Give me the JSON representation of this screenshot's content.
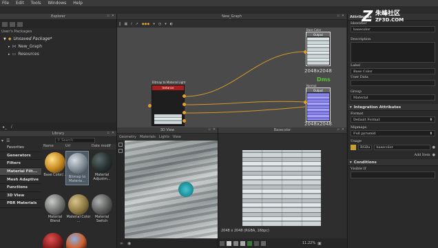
{
  "menu": [
    "File",
    "Edit",
    "Tools",
    "Windows",
    "Help"
  ],
  "explorer": {
    "title": "Explorer",
    "header": "User's Packages",
    "package": "Unsaved Package*",
    "items": [
      "New_Graph",
      "Resources"
    ]
  },
  "graph": {
    "title": "New_Graph",
    "nodes": {
      "base_color": {
        "title": "Base Color",
        "header": "Output",
        "res": "2048x2048"
      },
      "normal": {
        "title": "Normal",
        "header": "Output",
        "res": "2048x2048"
      },
      "source": {
        "title": "Bitmap to Material Light",
        "header": "Instance"
      }
    },
    "overlay": "Dms"
  },
  "library": {
    "title": "Library",
    "search_placeholder": "Search",
    "columns": [
      "Name",
      "Url",
      "Date modif"
    ],
    "categories": [
      "Favorites",
      "Generators",
      "Filters",
      "Material Filt...",
      "Mesh Adaptive",
      "Functions",
      "3D View",
      "PBR Materials"
    ],
    "items": [
      {
        "label": "Base Color/..."
      },
      {
        "label": "Bitmap to Materia..."
      },
      {
        "label": "Material Adjustm..."
      },
      {
        "label": "Material Blend"
      },
      {
        "label": "Material Color ..."
      },
      {
        "label": "Material Switch"
      }
    ]
  },
  "view3d": {
    "title": "3D View",
    "menu": [
      "Geometry",
      "Materials",
      "Lights",
      "View"
    ]
  },
  "view2d": {
    "title": "Basecolor",
    "status": "2048 x 2048 (RGBA, 16bpc)",
    "zoom": "11.22%"
  },
  "attributes": {
    "title": "Attributes",
    "identifier_label": "Identifier",
    "identifier_value": "basecolor",
    "description_label": "Description",
    "label_label": "Label",
    "label_value": "Base Color",
    "user_data_label": "User Data",
    "group_label": "Group",
    "group_value": "Material",
    "integration_header": "Integration Attributes",
    "format_label": "Format",
    "format_value": "Default Format",
    "mipmaps_label": "Mipmaps",
    "mipmaps_value": "Full pyramid",
    "usage_label": "Usage",
    "usage_value": "basecolor",
    "usage_item": "RGBa",
    "add_item": "Add Item",
    "conditions_header": "Conditions",
    "visible_if_label": "Visible If"
  },
  "watermark": {
    "text": "朱峰社区",
    "sub": "ZF3D.COM"
  }
}
